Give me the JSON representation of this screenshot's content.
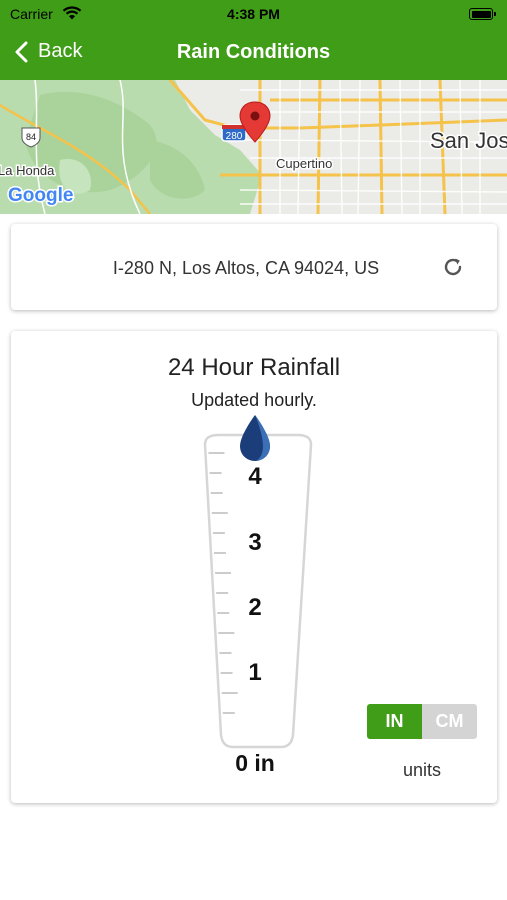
{
  "status": {
    "carrier": "Carrier",
    "time": "4:38 PM"
  },
  "nav": {
    "back_label": "Back",
    "title": "Rain Conditions"
  },
  "map": {
    "labels": {
      "city1": "San Jos",
      "city2": "Cupertino",
      "town": "La Honda",
      "hwy_280": "280",
      "hwy_84": "84",
      "logo": "Google"
    }
  },
  "address": {
    "text": "I-280 N, Los Altos, CA 94024, US"
  },
  "rain": {
    "title": "24 Hour Rainfall",
    "subtitle": "Updated hourly.",
    "scale": [
      "4",
      "3",
      "2",
      "1"
    ],
    "zero_label": "0 in",
    "level": 0
  },
  "units": {
    "options": [
      "IN",
      "CM"
    ],
    "selected": "IN",
    "label": "units"
  },
  "colors": {
    "brand": "#3f9d17",
    "drop_dark": "#1b3e7a",
    "drop_light": "#3b6fb6",
    "toggle_off": "#d4d4d4"
  }
}
